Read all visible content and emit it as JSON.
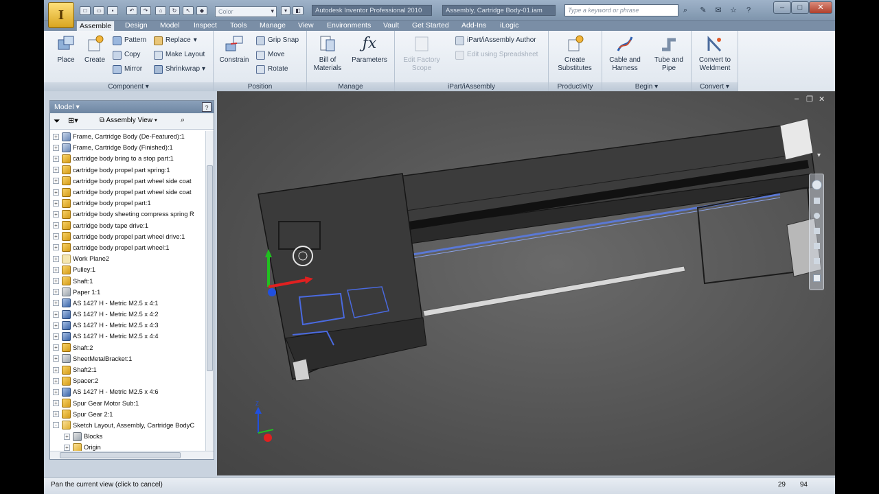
{
  "app": {
    "product_title": "Autodesk Inventor Professional 2010",
    "document_title": "Assembly, Cartridge Body-01.iam",
    "color_select": {
      "value": "Color"
    },
    "search_placeholder": "Type a keyword or phrase",
    "logo_letter": "I"
  },
  "tabs": [
    "Assemble",
    "Design",
    "Model",
    "Inspect",
    "Tools",
    "Manage",
    "View",
    "Environments",
    "Vault",
    "Get Started",
    "Add-Ins",
    "iLogic"
  ],
  "active_tab": "Assemble",
  "ribbon": {
    "component": {
      "title": "Component",
      "place": "Place",
      "create": "Create",
      "pattern": "Pattern",
      "copy": "Copy",
      "mirror": "Mirror",
      "replace": "Replace",
      "make_layout": "Make Layout",
      "shrinkwrap": "Shrinkwrap"
    },
    "position": {
      "title": "Position",
      "constrain": "Constrain",
      "grip_snap": "Grip Snap",
      "move": "Move",
      "rotate": "Rotate"
    },
    "manage": {
      "title": "Manage",
      "bom_line1": "Bill of",
      "bom_line2": "Materials",
      "parameters": "Parameters",
      "edit_factory_line1": "Edit Factory",
      "edit_factory_line2": "Scope"
    },
    "ipart": {
      "title": "iPart/iAssembly",
      "author": "iPart/iAssembly Author",
      "edit_spreadsheet": "Edit using Spreadsheet"
    },
    "productivity": {
      "title": "Productivity",
      "line1": "Create",
      "line2": "Substitutes"
    },
    "begin": {
      "title": "Begin",
      "cable_line1": "Cable and",
      "cable_line2": "Harness",
      "tube_line1": "Tube and",
      "tube_line2": "Pipe"
    },
    "convert": {
      "title": "Convert",
      "line1": "Convert to",
      "line2": "Weldment"
    }
  },
  "browser": {
    "header": "Model",
    "view_label": "Assembly View",
    "items": [
      {
        "label": "Frame, Cartridge Body (De-Featured):1",
        "icon": "asm",
        "exp": "+"
      },
      {
        "label": "Frame, Cartridge Body (Finished):1",
        "icon": "asm",
        "exp": "+"
      },
      {
        "label": "cartridge body bring to a stop part:1",
        "icon": "part",
        "exp": "+"
      },
      {
        "label": "cartridge body propel part spring:1",
        "icon": "part",
        "exp": "+"
      },
      {
        "label": "cartridge body propel part wheel side coat",
        "icon": "part",
        "exp": "+"
      },
      {
        "label": "cartridge body propel part wheel side coat",
        "icon": "part",
        "exp": "+"
      },
      {
        "label": "cartridge body propel part:1",
        "icon": "part",
        "exp": "+"
      },
      {
        "label": "cartridge body sheeting compress spring R",
        "icon": "part",
        "exp": "+"
      },
      {
        "label": "cartridge body tape drive:1",
        "icon": "part",
        "exp": "+"
      },
      {
        "label": "cartridge body propel part wheel drive:1",
        "icon": "part",
        "exp": "+"
      },
      {
        "label": "cartridge body propel part wheel:1",
        "icon": "part",
        "exp": "+"
      },
      {
        "label": "Work Plane2",
        "icon": "plane",
        "exp": "+"
      },
      {
        "label": "Pulley:1",
        "icon": "part",
        "exp": "+"
      },
      {
        "label": "Shaft:1",
        "icon": "part",
        "exp": "+"
      },
      {
        "label": "Paper 1:1",
        "icon": "sm",
        "exp": "+"
      },
      {
        "label": "AS 1427 H - Metric M2.5 x 4:1",
        "icon": "bolt",
        "exp": "+"
      },
      {
        "label": "AS 1427 H - Metric M2.5 x 4:2",
        "icon": "bolt",
        "exp": "+"
      },
      {
        "label": "AS 1427 H - Metric M2.5 x 4:3",
        "icon": "bolt",
        "exp": "+"
      },
      {
        "label": "AS 1427 H - Metric M2.5 x 4:4",
        "icon": "bolt",
        "exp": "+"
      },
      {
        "label": "Shaft:2",
        "icon": "part",
        "exp": "+"
      },
      {
        "label": "SheetMetalBracket:1",
        "icon": "sm",
        "exp": "+"
      },
      {
        "label": "Shaft2:1",
        "icon": "part",
        "exp": "+"
      },
      {
        "label": "Spacer:2",
        "icon": "part",
        "exp": "+"
      },
      {
        "label": "AS 1427 H - Metric M2.5 x 4:6",
        "icon": "bolt",
        "exp": "+"
      },
      {
        "label": "Spur Gear Motor Sub:1",
        "icon": "part",
        "exp": "+"
      },
      {
        "label": "Spur Gear 2:1",
        "icon": "part",
        "exp": "+"
      },
      {
        "label": "Sketch Layout, Assembly, Cartridge BodyC",
        "icon": "sketch",
        "exp": "-"
      },
      {
        "label": "Blocks",
        "icon": "sm",
        "exp": "+",
        "indent": true
      },
      {
        "label": "Origin",
        "icon": "sketch",
        "exp": "+",
        "indent": true
      }
    ]
  },
  "status": {
    "message": "Pan the current view (click to cancel)",
    "x": "29",
    "y": "94"
  },
  "colors": {
    "ribbon_bg": "#e3e9f0",
    "viewport_bg": "#555555",
    "axis_x": "#e02020",
    "axis_y": "#20c020",
    "axis_z": "#2050e0"
  }
}
